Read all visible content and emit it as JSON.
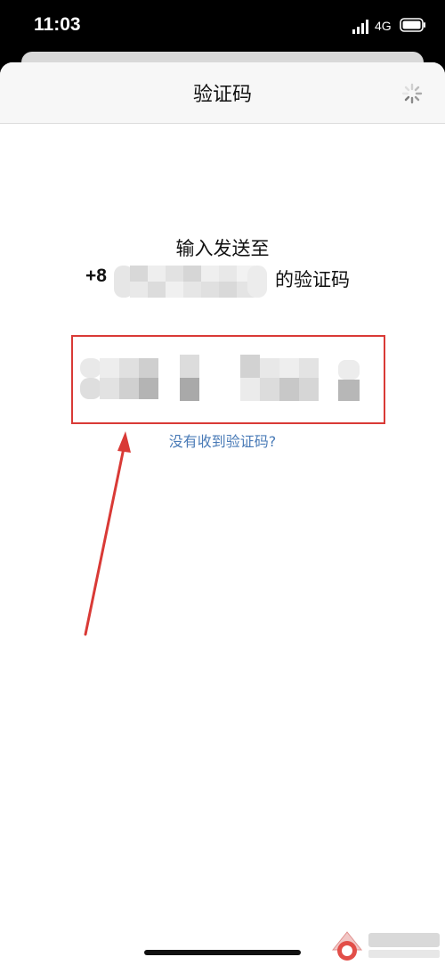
{
  "status_bar": {
    "time": "11:03",
    "network": "4G",
    "icons": [
      "signal-icon",
      "battery-icon"
    ]
  },
  "nav": {
    "title": "验证码",
    "right_icon": "spinner-icon"
  },
  "prompt": {
    "line1": "输入发送至",
    "phone_prefix": "+8",
    "phone_suffix": "的验证码"
  },
  "code_input": {
    "highlight_color": "#d93a36"
  },
  "resend": {
    "label": "没有收到验证码?"
  },
  "annotation": {
    "arrow_color": "#d93a36"
  },
  "watermark": {
    "icon": "android-logo-icon"
  }
}
